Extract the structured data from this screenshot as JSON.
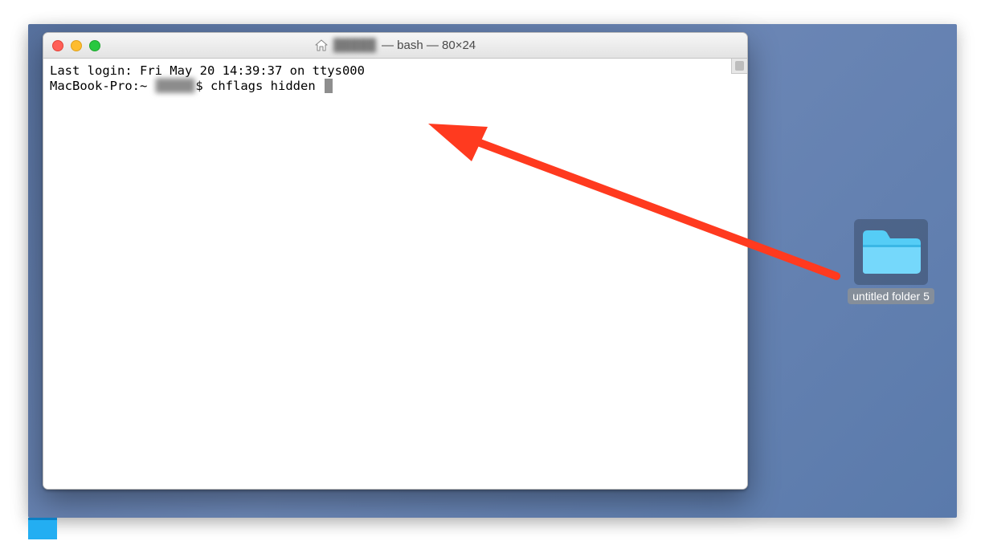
{
  "window": {
    "title_user": "█████",
    "title_after": " — bash — 80×24"
  },
  "terminal": {
    "line1": "Last login: Fri May 20 14:39:37 on ttys000",
    "prompt_host": "MacBook-Pro:~ ",
    "prompt_user_blur": "█████",
    "prompt_sigil": "$ ",
    "command": "chflags hidden "
  },
  "traffic": {
    "close": "close",
    "min": "minimize",
    "zoom": "zoom"
  },
  "desktop": {
    "folder_name": "untitled folder 5"
  },
  "annotation": {
    "arrow": "arrow-pointing-from-folder-to-terminal"
  }
}
